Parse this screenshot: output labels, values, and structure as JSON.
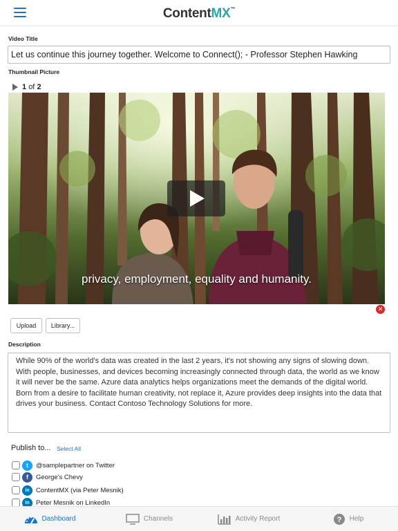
{
  "header": {
    "logo_content": "Content",
    "logo_mx": "MX",
    "logo_tm": "™",
    "menu_icon": "hamburger-menu-icon"
  },
  "video_title": {
    "label": "Video Title",
    "value": "Let us continue this journey together. Welcome to Connect(); - Professor Stephen Hawking"
  },
  "thumbnail": {
    "label": "Thumbnail Picture",
    "current": "1",
    "of_text": "of",
    "total": "2",
    "caption": "privacy, employment, equality and humanity.",
    "play_icon": "play-icon",
    "remove_icon": "remove-thumbnail-icon"
  },
  "buttons": {
    "upload": "Upload",
    "library": "Library..."
  },
  "description": {
    "label": "Description",
    "value": "While 90% of the world's data was created in the last 2 years, it's not showing any signs of slowing down. With people, businesses, and devices becoming increasingly connected through data, the world as we know it will never be the same. Azure data analytics helps organizations meet the demands of the digital world. Born from a desire to facilitate human creativity, not replace it, Azure provides deep insights into the data that drives your business. Contact Contoso Technology Solutions for more."
  },
  "publish": {
    "label": "Publish to...",
    "select_all": "Select All",
    "accounts": [
      {
        "name": "@samplepartner on Twitter",
        "network": "twitter",
        "glyph": "t",
        "color": "#1da1f2",
        "checked": false
      },
      {
        "name": "George's Chevy",
        "network": "facebook",
        "glyph": "f",
        "color": "#3b5998",
        "checked": false
      },
      {
        "name": "ContentMX (via Peter Mesnik)",
        "network": "linkedin",
        "glyph": "in",
        "color": "#0077b5",
        "checked": false
      },
      {
        "name": "Peter Mesnik on LinkedIn",
        "network": "linkedin",
        "glyph": "in",
        "color": "#0077b5",
        "checked": false
      }
    ]
  },
  "tabbar": {
    "tabs": [
      {
        "label": "Dashboard",
        "icon": "dashboard-gauge-icon",
        "active": true
      },
      {
        "label": "Channels",
        "icon": "monitor-icon",
        "active": false
      },
      {
        "label": "Activity Report",
        "icon": "bar-chart-icon",
        "active": false
      },
      {
        "label": "Help",
        "icon": "help-icon",
        "active": false
      }
    ],
    "active_color": "#1a73c9",
    "inactive_color": "#8a8a8a"
  }
}
